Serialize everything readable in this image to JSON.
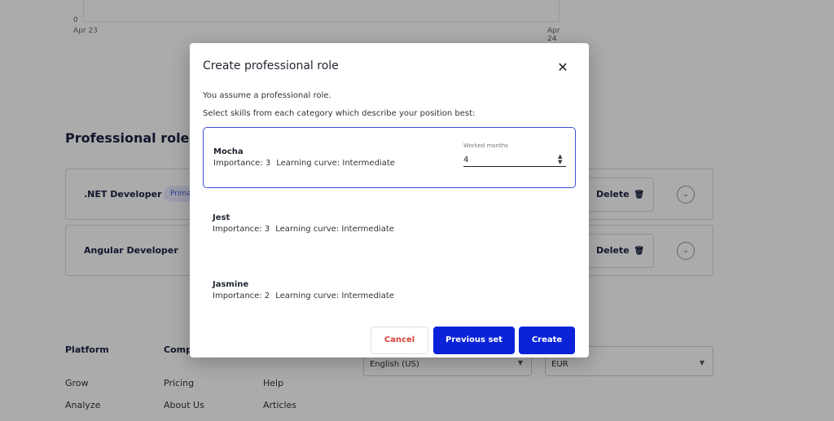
{
  "chart": {
    "zero_label": "0",
    "ticks": [
      "Apr 23",
      "Apr 24"
    ]
  },
  "background": {
    "section_title": "Professional roles",
    "roles": [
      {
        "name": ".NET Developer",
        "badge": "Prima",
        "delete_label": "Delete"
      },
      {
        "name": "Angular Developer",
        "delete_label": "Delete"
      }
    ],
    "footer": {
      "platform_heading": "Platform",
      "company_heading": "Comp",
      "platform_links": [
        "Grow",
        "Analyze"
      ],
      "company_links": [
        "Pricing",
        "About Us"
      ],
      "resources_links": [
        "Help",
        "Articles"
      ],
      "language_select": "English (US)",
      "currency_select": "EUR"
    }
  },
  "dialog": {
    "title": "Create professional role",
    "intro": "You assume a professional role.",
    "instruction": "Select skills from each category which describe your position best:",
    "worked_months_label": "Worked months",
    "worked_months_value": "4",
    "skills": [
      {
        "name": "Mocha",
        "importance": "Importance: 3",
        "learning_curve": "Learning curve: Intermediate"
      },
      {
        "name": "Jest",
        "importance": "Importance: 3",
        "learning_curve": "Learning curve: Intermediate"
      },
      {
        "name": "Jasmine",
        "importance": "Importance: 2",
        "learning_curve": "Learning curve: Intermediate"
      }
    ],
    "buttons": {
      "cancel": "Cancel",
      "previous": "Previous set",
      "create": "Create"
    }
  },
  "colors": {
    "primary": "#0a22d8",
    "cancel_text": "#d9423a",
    "selected_border": "#3b4fd6"
  }
}
